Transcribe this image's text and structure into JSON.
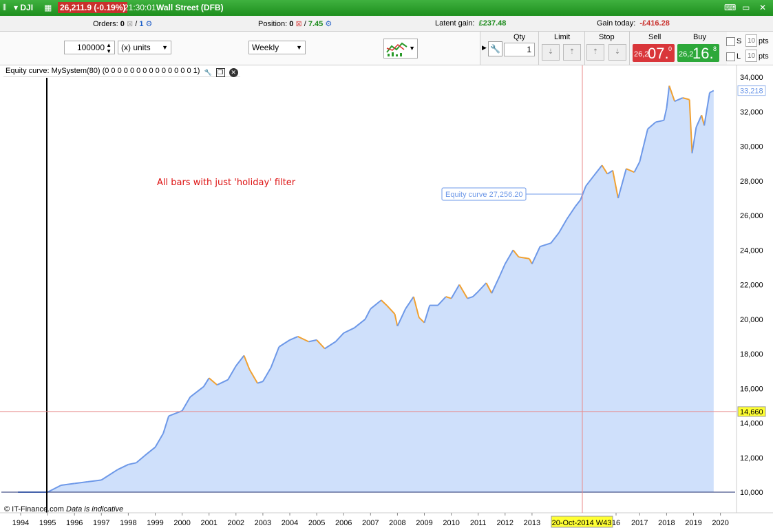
{
  "titlebar": {
    "symbol": "DJI",
    "price": "26,211.9 (-0.19%)",
    "time": "21:30:01",
    "name": "Wall Street (DFB)"
  },
  "status": {
    "orders_label": "Orders:",
    "orders_value": "0",
    "orders_right": "1",
    "position_label": "Position:",
    "position_value": "0",
    "position_right": "7.45",
    "latent_label": "Latent gain:",
    "latent_value": "£237.48",
    "gain_label": "Gain today:",
    "gain_value": "-£416.28"
  },
  "toolbar": {
    "quantity": "100000",
    "units": "(x) units",
    "timeframe": "Weekly"
  },
  "trade": {
    "qty_label": "Qty",
    "qty_value": "1",
    "limit_label": "Limit",
    "stop_label": "Stop",
    "sell_label": "Sell",
    "buy_label": "Buy",
    "sell_small": "26,2",
    "sell_big": "07.",
    "sell_sup": "0",
    "buy_small": "26,2",
    "buy_big": "16.",
    "buy_sup": "8",
    "s_label": "S",
    "l_label": "L",
    "s_pts": "10",
    "l_pts": "10",
    "pts_label": "pts"
  },
  "chart_legend": "Equity curve: MySystem(80) (0 0 0 0 0 0 0 0 0 0 0 0 0 0 1)",
  "chart_data": {
    "type": "area",
    "annotation": "All bars with just 'holiday' filter",
    "cursor_label": "Equity curve   27,256.20",
    "last_value_label": "33,218",
    "crosshair_value_label": "14,660",
    "crosshair_date_label": "20-Oct-2014 W43",
    "footer_source": "© IT-Finance.com",
    "footer_note": "Data is indicative",
    "ylim": [
      9500,
      34500
    ],
    "yticks": [
      "10,000",
      "12,000",
      "14,000",
      "16,000",
      "18,000",
      "20,000",
      "22,000",
      "24,000",
      "26,000",
      "28,000",
      "30,000",
      "32,000",
      "34,000"
    ],
    "xticks": [
      "1994",
      "1995",
      "1996",
      "1997",
      "1998",
      "1999",
      "2000",
      "2001",
      "2002",
      "2003",
      "2004",
      "2005",
      "2006",
      "2007",
      "2008",
      "2009",
      "2010",
      "2011",
      "2012",
      "2013",
      "16",
      "2017",
      "2018",
      "2019",
      "2020"
    ],
    "colors": {
      "fill": "#cfe0fb",
      "line": "#6d98e8",
      "down": "#f0a030",
      "crosshair": "#e88a8a"
    },
    "series": [
      {
        "values": [
          [
            1993.9,
            10000
          ],
          [
            1995.0,
            10000
          ],
          [
            1995.5,
            10400
          ],
          [
            1996.0,
            10500
          ],
          [
            1996.5,
            10600
          ],
          [
            1997.0,
            10700
          ],
          [
            1997.3,
            11000
          ],
          [
            1997.6,
            11300
          ],
          [
            1998.0,
            11600
          ],
          [
            1998.3,
            11700
          ],
          [
            1998.6,
            12100
          ],
          [
            1999.0,
            12600
          ],
          [
            1999.3,
            13400
          ],
          [
            1999.5,
            14400
          ],
          [
            2000.0,
            14700
          ],
          [
            2000.3,
            15500
          ],
          [
            2000.8,
            16100
          ],
          [
            2001.0,
            16600
          ],
          [
            2001.3,
            16200
          ],
          [
            2001.7,
            16500
          ],
          [
            2002.0,
            17300
          ],
          [
            2002.3,
            17900
          ],
          [
            2002.5,
            17100
          ],
          [
            2002.8,
            16300
          ],
          [
            2003.0,
            16400
          ],
          [
            2003.3,
            17200
          ],
          [
            2003.6,
            18400
          ],
          [
            2004.0,
            18800
          ],
          [
            2004.3,
            19000
          ],
          [
            2004.7,
            18700
          ],
          [
            2005.0,
            18800
          ],
          [
            2005.3,
            18300
          ],
          [
            2005.7,
            18700
          ],
          [
            2006.0,
            19200
          ],
          [
            2006.4,
            19500
          ],
          [
            2006.8,
            20000
          ],
          [
            2007.0,
            20600
          ],
          [
            2007.4,
            21100
          ],
          [
            2007.6,
            20800
          ],
          [
            2007.9,
            20300
          ],
          [
            2008.0,
            19600
          ],
          [
            2008.3,
            20600
          ],
          [
            2008.6,
            21300
          ],
          [
            2008.8,
            20100
          ],
          [
            2009.0,
            19800
          ],
          [
            2009.2,
            20800
          ],
          [
            2009.5,
            20800
          ],
          [
            2009.8,
            21300
          ],
          [
            2010.0,
            21200
          ],
          [
            2010.3,
            22000
          ],
          [
            2010.6,
            21200
          ],
          [
            2010.8,
            21300
          ],
          [
            2011.0,
            21600
          ],
          [
            2011.3,
            22100
          ],
          [
            2011.5,
            21500
          ],
          [
            2011.8,
            22500
          ],
          [
            2012.0,
            23200
          ],
          [
            2012.3,
            24000
          ],
          [
            2012.5,
            23600
          ],
          [
            2012.9,
            23500
          ],
          [
            2013.0,
            23200
          ],
          [
            2013.3,
            24200
          ],
          [
            2013.7,
            24400
          ],
          [
            2014.0,
            25000
          ],
          [
            2014.3,
            25800
          ],
          [
            2014.6,
            26500
          ],
          [
            2014.8,
            26900
          ],
          [
            2015.0,
            27700
          ],
          [
            2015.3,
            28300
          ],
          [
            2015.6,
            28900
          ],
          [
            2015.8,
            28400
          ],
          [
            2016.0,
            28600
          ],
          [
            2016.2,
            27000
          ],
          [
            2016.5,
            28700
          ],
          [
            2016.8,
            28500
          ],
          [
            2017.0,
            29100
          ],
          [
            2017.3,
            31000
          ],
          [
            2017.6,
            31400
          ],
          [
            2017.9,
            31500
          ],
          [
            2018.0,
            32200
          ],
          [
            2018.1,
            33500
          ],
          [
            2018.3,
            32600
          ],
          [
            2018.6,
            32800
          ],
          [
            2018.85,
            32700
          ],
          [
            2018.95,
            29600
          ],
          [
            2019.1,
            31100
          ],
          [
            2019.3,
            31800
          ],
          [
            2019.4,
            31200
          ],
          [
            2019.6,
            33100
          ],
          [
            2019.75,
            33218
          ]
        ]
      }
    ]
  }
}
